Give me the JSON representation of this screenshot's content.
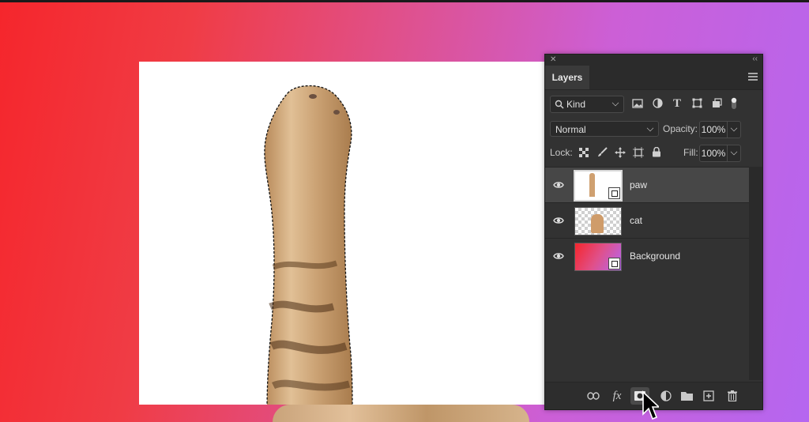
{
  "panel": {
    "tab_label": "Layers",
    "filter": {
      "label": "Kind"
    },
    "blend_mode": "Normal",
    "opacity_label": "Opacity:",
    "opacity_value": "100%",
    "lock_label": "Lock:",
    "fill_label": "Fill:",
    "fill_value": "100%"
  },
  "layers": [
    {
      "name": "paw",
      "selected": true,
      "visible": true,
      "smart_object": true
    },
    {
      "name": "cat",
      "selected": false,
      "visible": true,
      "smart_object": false
    },
    {
      "name": "Background",
      "selected": false,
      "visible": true,
      "smart_object": true
    }
  ],
  "colors": {
    "gradient_start": "#f5262c",
    "gradient_end": "#b566f0",
    "panel_bg": "#323232",
    "selected_layer_bg": "#474747"
  },
  "icons": {
    "filter_icons": [
      "image-filter-icon",
      "adjustment-filter-icon",
      "type-filter-icon",
      "shape-filter-icon",
      "smart-object-filter-icon",
      "filter-toggle-icon"
    ],
    "lock_icons": [
      "lock-transparent-icon",
      "lock-image-icon",
      "lock-position-icon",
      "lock-artboard-icon",
      "lock-all-icon"
    ],
    "bottom_icons": [
      "link-icon",
      "fx-icon",
      "add-mask-icon",
      "adjustment-layer-icon",
      "group-folder-icon",
      "new-layer-icon",
      "trash-icon"
    ]
  }
}
